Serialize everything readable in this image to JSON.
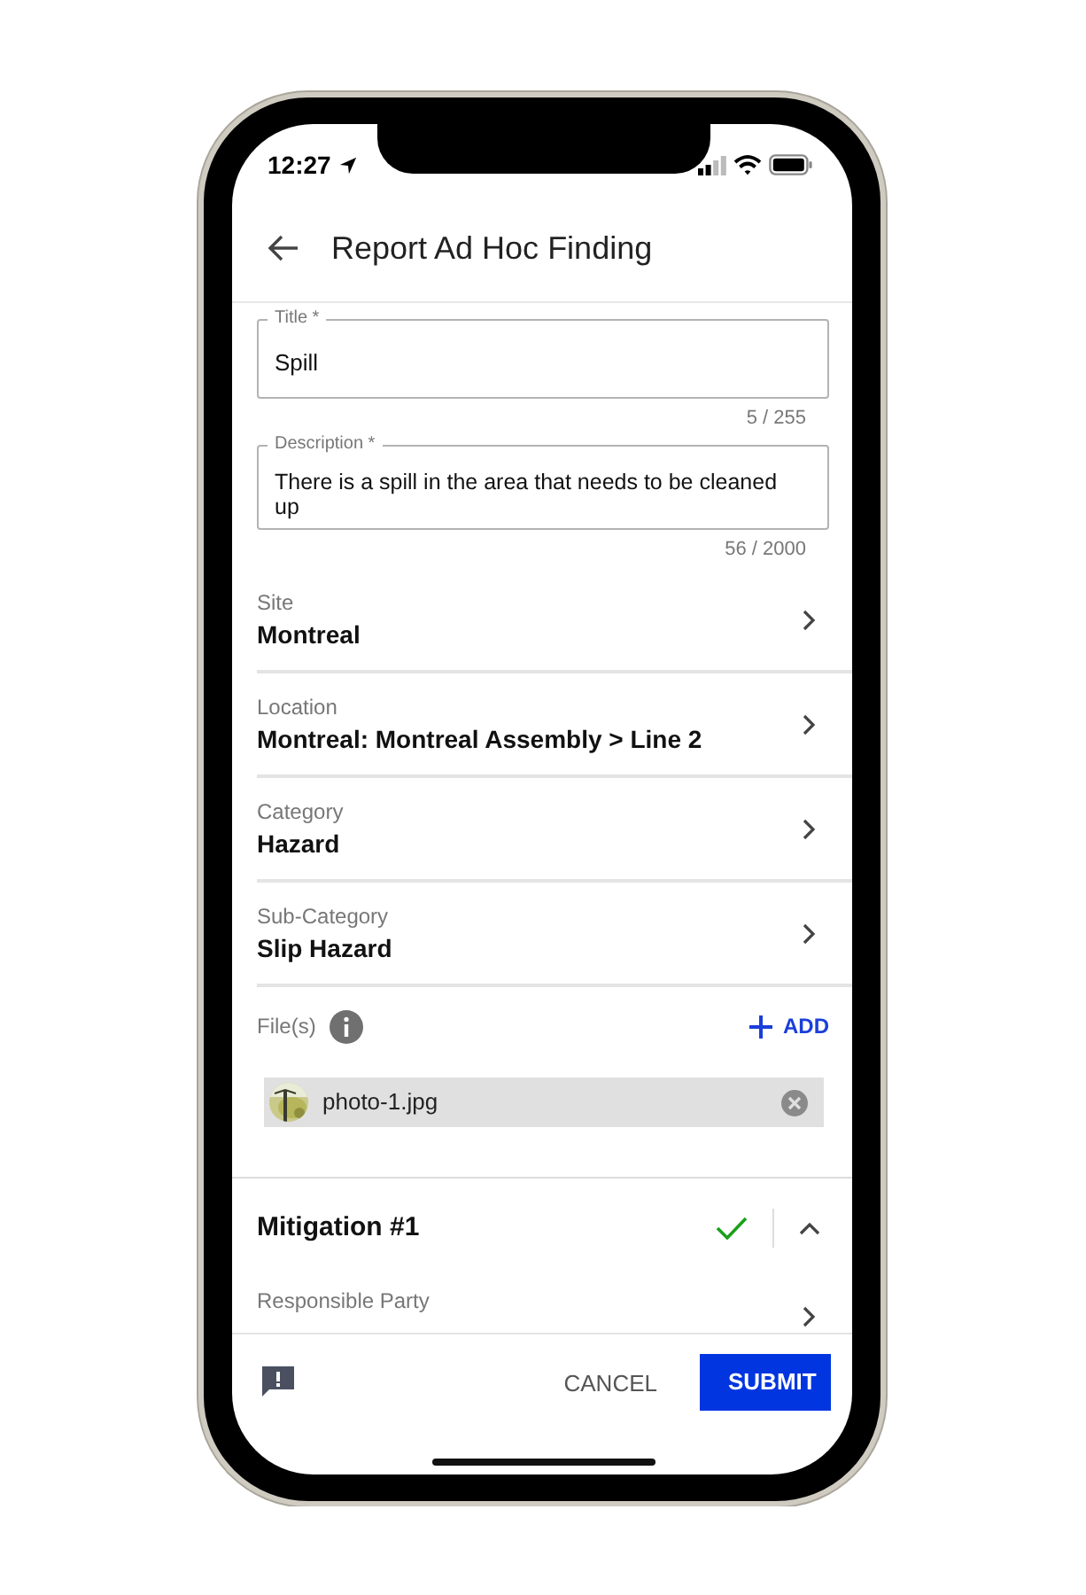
{
  "status_bar": {
    "time": "12:27"
  },
  "header": {
    "title": "Report Ad Hoc Finding"
  },
  "fields": [
    {
      "kind": "single",
      "label": "Title *",
      "value": "Spill",
      "counter": "5 / 255"
    },
    {
      "kind": "multi",
      "label": "Description *",
      "value": "There is a spill in the area that needs to be cleaned up",
      "counter": "56 / 2000"
    }
  ],
  "pickers": [
    {
      "label": "Site",
      "value": "Montreal"
    },
    {
      "label": "Location",
      "value": "Montreal: Montreal Assembly > Line 2"
    },
    {
      "label": "Category",
      "value": "Hazard"
    },
    {
      "label": "Sub-Category",
      "value": "Slip Hazard"
    }
  ],
  "files": {
    "label": "File(s)",
    "add": "ADD",
    "items": [
      {
        "name": "photo-1.jpg"
      }
    ]
  },
  "mitigation": {
    "title": "Mitigation #1",
    "complete": true,
    "expanded": true,
    "rows": [
      {
        "label": "Responsible Party"
      }
    ]
  },
  "footer": {
    "cancel": "CANCEL",
    "submit": "SUBMIT"
  }
}
